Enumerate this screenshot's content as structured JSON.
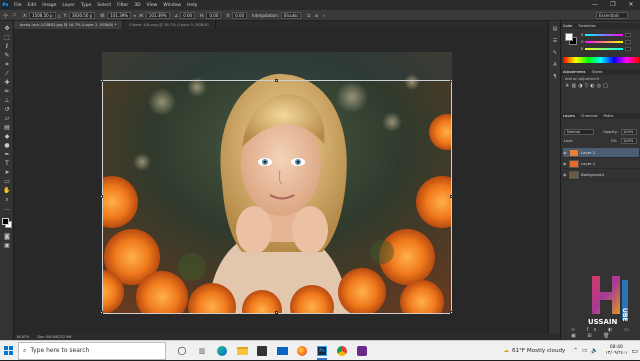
{
  "menubar": {
    "logo": "Ps",
    "items": [
      "File",
      "Edit",
      "Image",
      "Layer",
      "Type",
      "Select",
      "Filter",
      "3D",
      "View",
      "Window",
      "Help"
    ],
    "window_controls": [
      "—",
      "❐",
      "✕"
    ]
  },
  "options_bar": {
    "x_label": "X:",
    "x_value": "1508.50 p",
    "y_label": "Y:",
    "y_value": "3830.50 p",
    "w_label": "W:",
    "w_value": "101.39%",
    "h_label": "H:",
    "h_value": "101.39%",
    "angle_value": "0.00",
    "h_skew_label": "H:",
    "h_skew_value": "0.00",
    "v_skew_label": "V:",
    "v_skew_value": "0.00",
    "interpolation_label": "Interpolation:",
    "interpolation_value": "Bicubic",
    "workspace": "Essentials"
  },
  "doc_tabs": [
    {
      "label": "jaeko-loch-103881.jpg @ 16.7% (Layer 2, RGB/8) *",
      "active": true
    },
    {
      "label": "Flower 4/8.png @ 16.7% (Layer 0, RGB/8)",
      "active": false
    }
  ],
  "statusbar": {
    "zoom": "16.67%",
    "doc": "Doc: 86.0M/232.9M"
  },
  "panels": {
    "color_tabs": [
      "Color",
      "Swatches"
    ],
    "adjustments_tabs": [
      "Adjustments",
      "Styles"
    ],
    "adjustments_hint": "Add an adjustment",
    "layers_tabs": [
      "Layers",
      "Channels",
      "Paths"
    ],
    "blend_mode": "Normal",
    "opacity_label": "Opacity:",
    "opacity_value": "100%",
    "lock_label": "Lock:",
    "fill_label": "Fill:",
    "fill_value": "100%",
    "layers": [
      {
        "name": "Layer 2",
        "selected": true
      },
      {
        "name": "Layer 1",
        "selected": false
      },
      {
        "name": "Background",
        "selected": false
      }
    ]
  },
  "colors": {
    "accent": "#31a8ff",
    "selected_layer": "#4b5d73",
    "taskbar": "#f0f0f0"
  },
  "taskbar": {
    "search_placeholder": "Type here to search",
    "weather": "61°F  Mostly cloudy",
    "time": "08:40",
    "date": "١-١٣/٠٩/٢٤"
  },
  "watermark": {
    "text_top": "H",
    "text_side": "UBE",
    "text_bottom": "USSAIN"
  }
}
